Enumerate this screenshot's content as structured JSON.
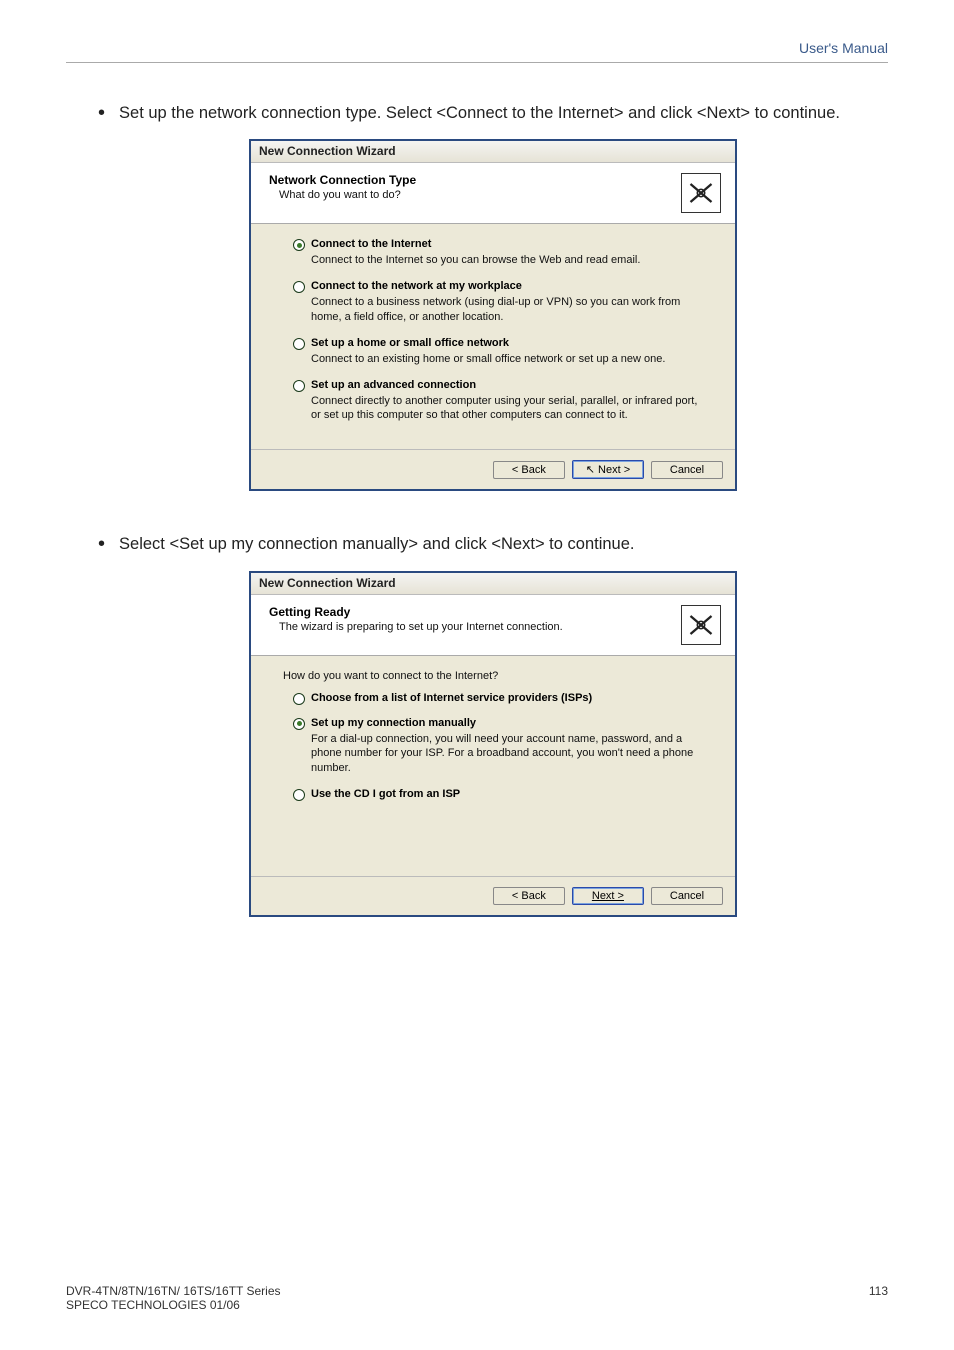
{
  "header": {
    "manual_label": "User's Manual"
  },
  "intro": {
    "para1": "Set up the network connection type. Select <Connect to the Internet> and click <Next> to continue.",
    "para2": "Select <Set up my connection manually> and click <Next> to continue."
  },
  "dialog1": {
    "title": "New Connection Wizard",
    "htitle": "Network Connection Type",
    "hsub": "What do you want to do?",
    "options": [
      {
        "label": "Connect to the Internet",
        "desc": "Connect to the Internet so you can browse the Web and read email.",
        "checked": true
      },
      {
        "label": "Connect to the network at my workplace",
        "desc": "Connect to a business network (using dial-up or VPN) so you can work from home, a field office, or another location.",
        "checked": false
      },
      {
        "label": "Set up a home or small office network",
        "desc": "Connect to an existing home or small office network or set up a new one.",
        "checked": false
      },
      {
        "label": "Set up an advanced connection",
        "desc": "Connect directly to another computer using your serial, parallel, or infrared port, or set up this computer so that other computers can connect to it.",
        "checked": false
      }
    ],
    "buttons": {
      "back": "< Back",
      "next": "Next >",
      "cancel": "Cancel"
    }
  },
  "dialog2": {
    "title": "New Connection Wizard",
    "htitle": "Getting Ready",
    "hsub": "The wizard is preparing to set up your Internet connection.",
    "question": "How do you want to connect to the Internet?",
    "options": [
      {
        "label": "Choose from a list of Internet service providers (ISPs)",
        "desc": "",
        "checked": false
      },
      {
        "label": "Set up my connection manually",
        "desc": "For a dial-up connection, you will need your account name, password, and a phone number for your ISP. For a broadband account, you won't need a phone number.",
        "checked": true
      },
      {
        "label": "Use the CD I got from an ISP",
        "desc": "",
        "checked": false
      }
    ],
    "buttons": {
      "back": "< Back",
      "next": "Next >",
      "cancel": "Cancel"
    }
  },
  "footer": {
    "line1": "DVR-4TN/8TN/16TN/ 16TS/16TT Series",
    "line2": "SPECO TECHNOLOGIES 01/06",
    "page": "113"
  }
}
